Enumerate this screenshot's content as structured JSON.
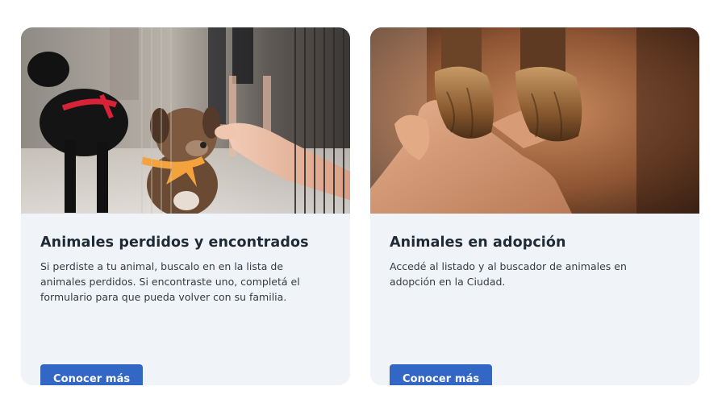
{
  "cards": [
    {
      "image_alt": "puppy-at-shelter-photo",
      "title": "Animales perdidos y encontrados",
      "description": "Si perdiste a tu animal, buscalo en en la lista de animales perdidos. Si encontraste uno, completá el formulario para que pueda volver con su familia.",
      "button_label": "Conocer más"
    },
    {
      "image_alt": "dog-paws-in-hand-photo",
      "title": "Animales en adopción",
      "description": "Accedé al listado y al buscador de animales en adopción en la Ciudad.",
      "button_label": "Conocer más"
    }
  ],
  "colors": {
    "card_background": "#f0f4f8",
    "button_background": "#3367c6",
    "title_text": "#1f2a37"
  }
}
